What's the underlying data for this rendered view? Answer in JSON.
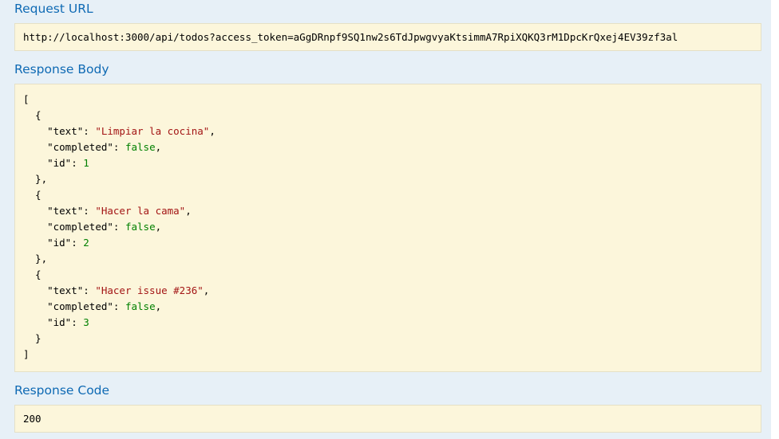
{
  "request_url": {
    "heading": "Request URL",
    "value": "http://localhost:3000/api/todos?access_token=aGgDRnpf9SQ1nw2s6TdJpwgvyaKtsimmA7RpiXQKQ3rM1DpcKrQxej4EV39zf3al"
  },
  "response_body": {
    "heading": "Response Body",
    "lines": [
      [
        {
          "t": "punct",
          "v": "["
        }
      ],
      [
        {
          "t": "punct",
          "v": "  {"
        }
      ],
      [
        {
          "t": "punct",
          "v": "    "
        },
        {
          "t": "key",
          "v": "\"text\""
        },
        {
          "t": "punct",
          "v": ": "
        },
        {
          "t": "string",
          "v": "\"Limpiar la cocina\""
        },
        {
          "t": "punct",
          "v": ","
        }
      ],
      [
        {
          "t": "punct",
          "v": "    "
        },
        {
          "t": "key",
          "v": "\"completed\""
        },
        {
          "t": "punct",
          "v": ": "
        },
        {
          "t": "literal",
          "v": "false"
        },
        {
          "t": "punct",
          "v": ","
        }
      ],
      [
        {
          "t": "punct",
          "v": "    "
        },
        {
          "t": "key",
          "v": "\"id\""
        },
        {
          "t": "punct",
          "v": ": "
        },
        {
          "t": "literal",
          "v": "1"
        }
      ],
      [
        {
          "t": "punct",
          "v": "  },"
        }
      ],
      [
        {
          "t": "punct",
          "v": "  {"
        }
      ],
      [
        {
          "t": "punct",
          "v": "    "
        },
        {
          "t": "key",
          "v": "\"text\""
        },
        {
          "t": "punct",
          "v": ": "
        },
        {
          "t": "string",
          "v": "\"Hacer la cama\""
        },
        {
          "t": "punct",
          "v": ","
        }
      ],
      [
        {
          "t": "punct",
          "v": "    "
        },
        {
          "t": "key",
          "v": "\"completed\""
        },
        {
          "t": "punct",
          "v": ": "
        },
        {
          "t": "literal",
          "v": "false"
        },
        {
          "t": "punct",
          "v": ","
        }
      ],
      [
        {
          "t": "punct",
          "v": "    "
        },
        {
          "t": "key",
          "v": "\"id\""
        },
        {
          "t": "punct",
          "v": ": "
        },
        {
          "t": "literal",
          "v": "2"
        }
      ],
      [
        {
          "t": "punct",
          "v": "  },"
        }
      ],
      [
        {
          "t": "punct",
          "v": "  {"
        }
      ],
      [
        {
          "t": "punct",
          "v": "    "
        },
        {
          "t": "key",
          "v": "\"text\""
        },
        {
          "t": "punct",
          "v": ": "
        },
        {
          "t": "string",
          "v": "\"Hacer issue #236\""
        },
        {
          "t": "punct",
          "v": ","
        }
      ],
      [
        {
          "t": "punct",
          "v": "    "
        },
        {
          "t": "key",
          "v": "\"completed\""
        },
        {
          "t": "punct",
          "v": ": "
        },
        {
          "t": "literal",
          "v": "false"
        },
        {
          "t": "punct",
          "v": ","
        }
      ],
      [
        {
          "t": "punct",
          "v": "    "
        },
        {
          "t": "key",
          "v": "\"id\""
        },
        {
          "t": "punct",
          "v": ": "
        },
        {
          "t": "literal",
          "v": "3"
        }
      ],
      [
        {
          "t": "punct",
          "v": "  }"
        }
      ],
      [
        {
          "t": "punct",
          "v": "]"
        }
      ]
    ]
  },
  "response_code": {
    "heading": "Response Code",
    "value": "200"
  },
  "colors": {
    "heading": "#0f6ab4",
    "code_background": "#fcf6db",
    "code_border": "#e5e0c6",
    "panel_background": "#e7f0f7",
    "json_string": "#a31515",
    "json_literal": "#008000"
  }
}
